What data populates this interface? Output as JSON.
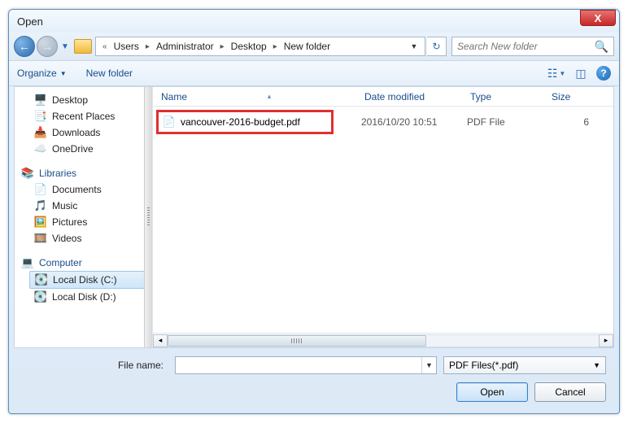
{
  "window": {
    "title": "Open"
  },
  "breadcrumb": {
    "prefix_chevrons": "«",
    "items": [
      "Users",
      "Administrator",
      "Desktop",
      "New folder"
    ]
  },
  "search": {
    "placeholder": "Search New folder"
  },
  "toolbar": {
    "organize": "Organize",
    "new_folder": "New folder"
  },
  "sidebar": {
    "favorites": {
      "desktop": "Desktop",
      "recent": "Recent Places",
      "downloads": "Downloads",
      "onedrive": "OneDrive"
    },
    "libraries": {
      "head": "Libraries",
      "documents": "Documents",
      "music": "Music",
      "pictures": "Pictures",
      "videos": "Videos"
    },
    "computer": {
      "head": "Computer",
      "c": "Local Disk (C:)",
      "d": "Local Disk (D:)"
    }
  },
  "columns": {
    "name": "Name",
    "date": "Date modified",
    "type": "Type",
    "size": "Size"
  },
  "files": [
    {
      "name": "vancouver-2016-budget.pdf",
      "date": "2016/10/20 10:51",
      "type": "PDF File",
      "size": "6"
    }
  ],
  "filename": {
    "label": "File name:",
    "value": ""
  },
  "filter": {
    "label": "PDF Files(*.pdf)"
  },
  "buttons": {
    "open": "Open",
    "cancel": "Cancel"
  }
}
